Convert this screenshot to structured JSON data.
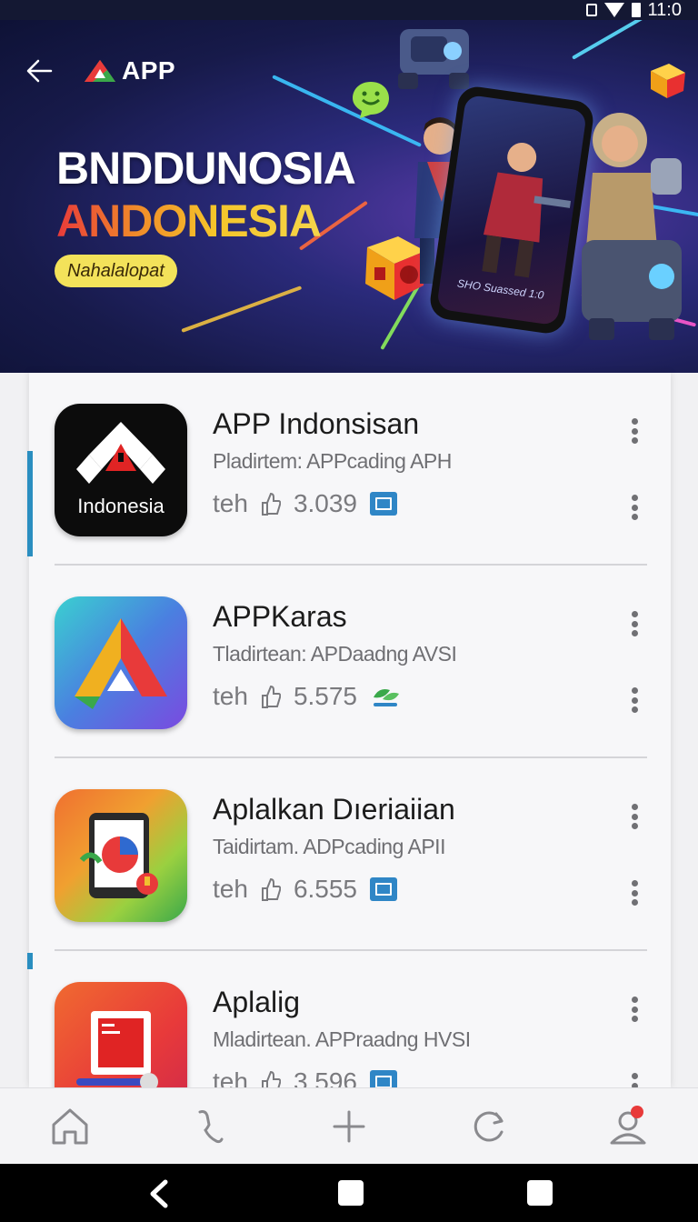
{
  "status_bar": {
    "time": "11:0"
  },
  "banner": {
    "logo_text": "APP",
    "headline_line1": "BNDDUNOSIA",
    "headline_line2": "ANDONESIA",
    "pill_label": "Nahalalopat",
    "phone_caption": "SHO Suassed 1:0"
  },
  "apps": [
    {
      "icon_text": "Indonesia",
      "title": "APP Indonsisan",
      "subtitle": "Pladirtem: APPcading APH",
      "meta_label": "teh",
      "count": "3.039",
      "badge": "chart-badge-icon"
    },
    {
      "icon_text": "",
      "title": "APPKaras",
      "subtitle": "Tladirtean: APDaadng AVSI",
      "meta_label": "teh",
      "count": "5.575",
      "badge": "leaf-badge-icon"
    },
    {
      "icon_text": "",
      "title": "Aplalkan Dıeriaiian",
      "subtitle": "Taidirtam. ADPcading APII",
      "meta_label": "teh",
      "count": "6.555",
      "badge": "chart-badge-icon"
    },
    {
      "icon_text": "",
      "title": "Aplalig",
      "subtitle": "Mladirtean. APPraadng HVSI",
      "meta_label": "teh",
      "count": "3.596",
      "badge": "chart-badge-icon"
    }
  ],
  "bottom_nav": [
    "home-icon",
    "phone-icon",
    "plus-icon",
    "refresh-icon",
    "profile-icon"
  ],
  "colors": {
    "accent_blue": "#2f86c6",
    "banner_bg": "#171a4a",
    "pill_yellow": "#f3e25a"
  }
}
